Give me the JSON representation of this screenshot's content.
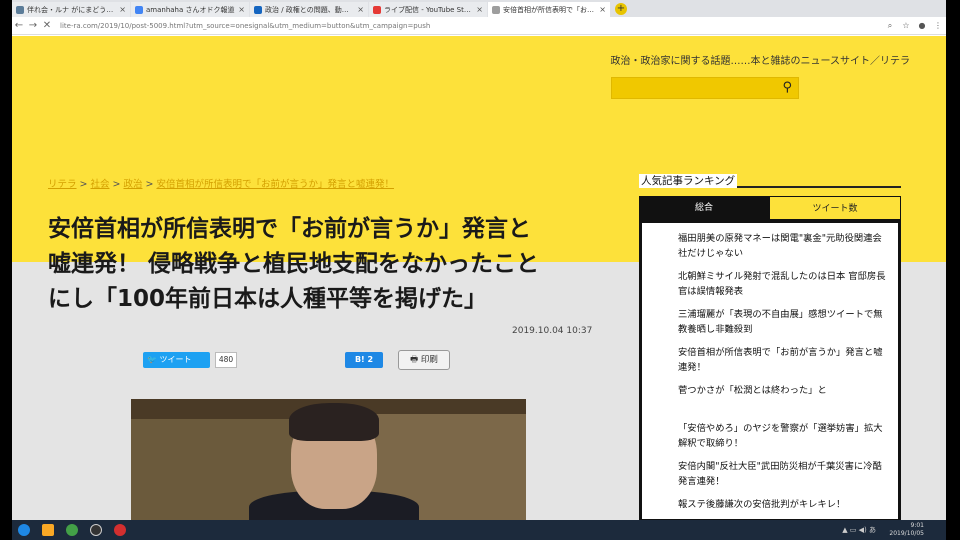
{
  "browser": {
    "tabs": [
      {
        "label": "伴れ会・ルナ がにまどうれゃ不常の",
        "color": "#5b7c99"
      },
      {
        "label": "amanhaha さんオドク報道",
        "color": "#4285f4"
      },
      {
        "label": "政治 / 政権との問題、動画をご読む",
        "color": "#1565c0"
      },
      {
        "label": "ライブ配信 - YouTube Studio",
        "color": "#e53935"
      },
      {
        "label": "安倍首相が所信表明で「お前が言",
        "color": "#9e9e9e"
      }
    ],
    "new_tab": "+",
    "url": "lite-ra.com/2019/10/post-5009.html?utm_source=onesignal&utm_medium=button&utm_campaign=push",
    "nav": {
      "back": "←",
      "forward": "→",
      "reload": "✕"
    },
    "tools": [
      "⌕",
      "☆",
      "●",
      "⋮"
    ]
  },
  "site": {
    "tagline": "政治・政治家に関する話題……本と雑誌のニュースサイト／リテラ",
    "search_icon": "⚲"
  },
  "breadcrumb": [
    {
      "label": "リテラ"
    },
    {
      "label": "社会"
    },
    {
      "label": "政治"
    },
    {
      "label": "安倍首相が所信表明で「お前が言うか」発言と嘘連発！"
    }
  ],
  "breadcrumb_sep": ">",
  "article": {
    "title_lines": [
      "安倍首相が所信表明で「お前が言うか」発言と",
      "嘘連発！ 侵略戦争と植民地支配をなかったこと",
      "にし「100年前日本は人種平等を掲げた」"
    ],
    "date": "2019.10.04 10:37",
    "tweet_label": "ツイート",
    "tweet_count": "480",
    "hatena_label": "B! 2",
    "print_label": "印刷"
  },
  "sidebar": {
    "heading": "人気記事ランキング",
    "tabs": [
      {
        "label": "総合"
      },
      {
        "label": "ツイート数"
      }
    ],
    "items": [
      "福田朋美の原発マネーは関電\"裏金\"元助役関連会社だけじゃない",
      "北朝鮮ミサイル発射で混乱したのは日本 官邸房長官は誤情報発表",
      "三浦瑠麗が「表現の不自由展」感想ツイートで無教養晒し非難殺到",
      "安倍首相が所信表明で「お前が言うか」発言と嘘連発！",
      "菅つかさが「松潤とは終わった」と",
      "「安倍やめろ」のヤジを警察が「選挙妨害」拡大解釈で取締り！",
      "安倍内閣\"反社大臣\"武田防災相が千葉災害に冷酷発言連発！",
      "報ステ後藤謙次の安倍批判がキレキレ！"
    ]
  },
  "taskbar": {
    "apps": [
      "ie",
      "folder",
      "chrome",
      "obs",
      "flame"
    ],
    "time": "9:01",
    "date": "2019/10/05"
  },
  "colors": {
    "site_yellow": "#fde13a",
    "twitter": "#1da1f2",
    "hatena": "#1e88e5"
  }
}
